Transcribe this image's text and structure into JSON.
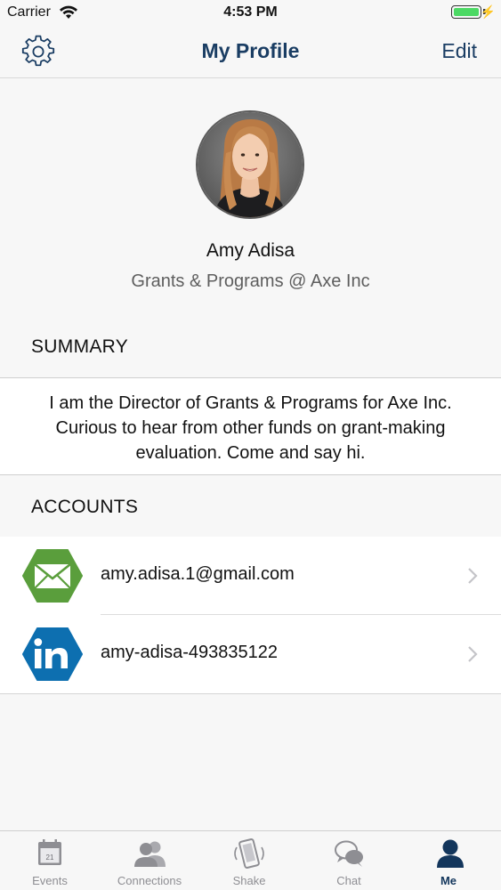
{
  "status_bar": {
    "carrier": "Carrier",
    "time": "4:53 PM"
  },
  "nav": {
    "title": "My Profile",
    "edit_label": "Edit",
    "settings_icon": "gear-icon"
  },
  "profile": {
    "name": "Amy Adisa",
    "title": "Grants & Programs @ Axe Inc"
  },
  "summary": {
    "heading": "SUMMARY",
    "text": "I am the Director of Grants & Programs for Axe Inc. Curious to hear from other funds on grant-making evaluation. Come and say hi."
  },
  "accounts": {
    "heading": "ACCOUNTS",
    "items": [
      {
        "icon": "email-icon",
        "label": "amy.adisa.1@gmail.com",
        "color": "#5a9e3c"
      },
      {
        "icon": "linkedin-icon",
        "label": "amy-adisa-493835122",
        "color": "#0d6fb0"
      }
    ]
  },
  "tabs": [
    {
      "label": "Events",
      "icon": "calendar-icon",
      "calendar_day": "21"
    },
    {
      "label": "Connections",
      "icon": "people-icon"
    },
    {
      "label": "Shake",
      "icon": "shake-phone-icon"
    },
    {
      "label": "Chat",
      "icon": "chat-bubbles-icon"
    },
    {
      "label": "Me",
      "icon": "person-icon",
      "active": true
    }
  ],
  "colors": {
    "accent": "#1a3d63",
    "inactive_tab": "#8e8e93",
    "battery": "#4cd964"
  }
}
